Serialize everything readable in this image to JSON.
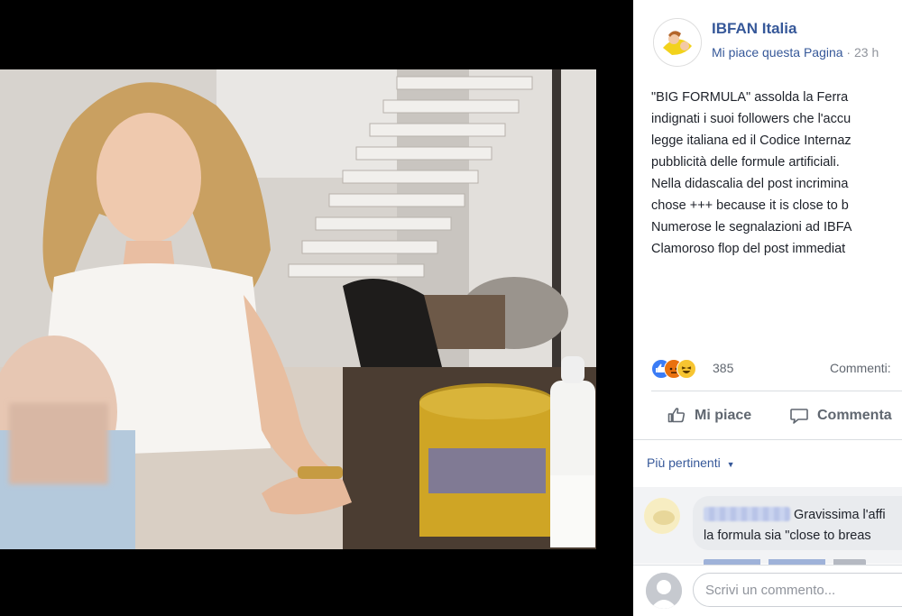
{
  "post": {
    "page_name": "IBFAN Italia",
    "like_page_label": "Mi piace questa Pagina",
    "separator": " · ",
    "time": "23 h",
    "text_lines": [
      "\"BIG FORMULA\" assolda la Ferra",
      "indignati i suoi followers che l'accu",
      "legge italiana ed il Codice Internaz",
      "pubblicità delle formule artificiali.",
      "Nella didascalia del post incrimina",
      "chose +++ because it is close to b",
      "Numerose le segnalazioni ad IBFA",
      "Clamoroso flop del post immediat"
    ],
    "reaction_count": "385",
    "comments_label": "Commenti:"
  },
  "actions": {
    "like_label": "Mi piace",
    "comment_label": "Commenta"
  },
  "comments": {
    "relevance_label": "Più pertinenti",
    "relevance_arrow": "▼",
    "items": [
      {
        "text_line1": "Gravissima l'affi",
        "text_line2": "la formula sia \"close to breas"
      }
    ],
    "write_placeholder": "Scrivi un commento..."
  },
  "colors": {
    "link": "#365899",
    "text": "#1d2129",
    "muted": "#90949c",
    "like_reaction": "#3b7cf5",
    "angry_reaction": "#e9710f",
    "haha_reaction": "#f7c531"
  },
  "icons": [
    "page-avatar",
    "like-reaction-icon",
    "angry-reaction-icon",
    "haha-reaction-icon",
    "thumbs-up-icon",
    "comment-icon",
    "relevance-dropdown-icon",
    "user-avatar"
  ]
}
